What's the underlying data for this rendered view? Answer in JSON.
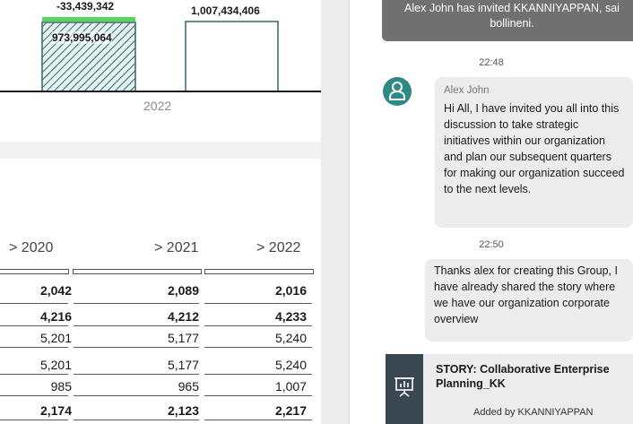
{
  "chart": {
    "label_variance": "-33,439,342",
    "label_total": "1,007,434,406",
    "label_bar": "973,995,064",
    "year": "2022"
  },
  "chart_data": {
    "type": "bar",
    "categories": [
      "2022"
    ],
    "series": [
      {
        "values": [
          973995064
        ]
      },
      {
        "values": [
          1007434406
        ]
      }
    ],
    "annotations": [
      "-33,439,342"
    ]
  },
  "table": {
    "headers": [
      "> 2020",
      "> 2021",
      "> 2022"
    ],
    "rows": [
      {
        "values": [
          "2,042",
          "2,089",
          "2,016"
        ],
        "bold": true
      },
      {
        "values": [
          "4,216",
          "4,212",
          "4,233"
        ],
        "bold": true
      },
      {
        "values": [
          "5,201",
          "5,177",
          "5,240"
        ],
        "bold": false
      },
      {
        "values": [
          "5,201",
          "5,177",
          "5,240"
        ],
        "bold": false
      },
      {
        "values": [
          "985",
          "965",
          "1,007"
        ],
        "bold": false
      },
      {
        "values": [
          "2,174",
          "2,123",
          "2,217"
        ],
        "bold": true
      }
    ]
  },
  "chat": {
    "system_message_line1": "Alex John has invited KKANNIYAPPAN, sai",
    "system_message_line2": "bollineni.",
    "time1": "22:48",
    "author1": "Alex John",
    "message1": "Hi All, I have invited you all into this discussion to take strategic initiatives within our organization and plan our subsequent quarters for making our organization succeed to the next levels.",
    "time2": "22:50",
    "message2": "Thanks alex for creating this Group, I have already shared the story where we have our organization corporate overview",
    "story_title": "STORY: Collaborative Enterprise Planning_KK",
    "story_added": "Added by KKANNIYAPPAN",
    "colors": {
      "avatar": "#2f8a85",
      "banner": "#707070",
      "story_icon_bg": "#3a4652",
      "variance_bar": "#5cd35c",
      "hatch": "#2f6a66"
    },
    "icons": [
      "user-icon",
      "presentation-chart-icon"
    ]
  }
}
